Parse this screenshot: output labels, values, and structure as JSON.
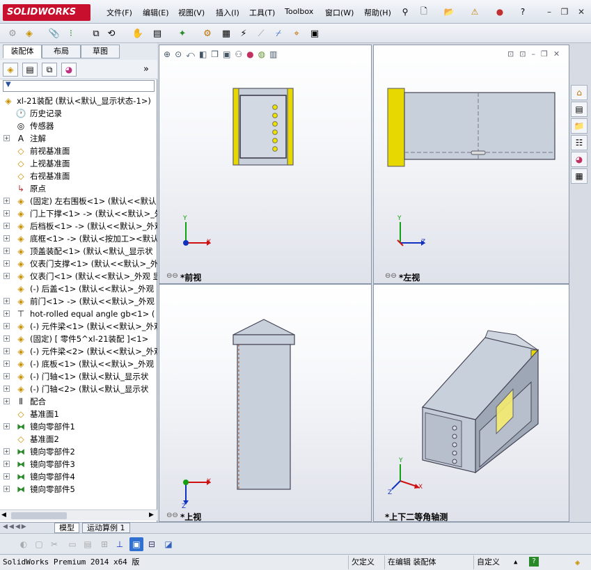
{
  "app": {
    "logo_text": "SOLIDWORKS"
  },
  "menu": [
    {
      "label": "文件(F)"
    },
    {
      "label": "编辑(E)"
    },
    {
      "label": "视图(V)"
    },
    {
      "label": "插入(I)"
    },
    {
      "label": "工具(T)"
    },
    {
      "label": "Toolbox"
    },
    {
      "label": "窗口(W)"
    },
    {
      "label": "帮助(H)"
    }
  ],
  "panel_tabs": [
    {
      "label": "装配体"
    },
    {
      "label": "布局"
    },
    {
      "label": "草图"
    }
  ],
  "tree": {
    "root": "xl-21装配  (默认<默认_显示状态-1>)",
    "items": [
      {
        "label": "历史记录",
        "icon": "history-icon",
        "glyph": "🕐",
        "expand": false
      },
      {
        "label": "传感器",
        "icon": "sensor-icon",
        "glyph": "◎",
        "expand": false
      },
      {
        "label": "注解",
        "icon": "annotation-icon",
        "glyph": "A",
        "expand": true
      },
      {
        "label": "前视基准面",
        "icon": "plane-icon",
        "glyph": "◇",
        "expand": false
      },
      {
        "label": "上视基准面",
        "icon": "plane-icon",
        "glyph": "◇",
        "expand": false
      },
      {
        "label": "右视基准面",
        "icon": "plane-icon",
        "glyph": "◇",
        "expand": false
      },
      {
        "label": "原点",
        "icon": "origin-icon",
        "glyph": "↳",
        "expand": false
      },
      {
        "label": "(固定) 左右围板<1> (默认<<默认",
        "icon": "part-icon",
        "glyph": "◈",
        "expand": true
      },
      {
        "label": "门上下撑<1> -> (默认<<默认>_外",
        "icon": "part-icon",
        "glyph": "◈",
        "expand": true
      },
      {
        "label": "后档板<1> -> (默认<<默认>_外观",
        "icon": "part-icon",
        "glyph": "◈",
        "expand": true
      },
      {
        "label": "底框<1> -> (默认<按加工><默认",
        "icon": "part-icon",
        "glyph": "◈",
        "expand": true
      },
      {
        "label": "顶盖装配<1> (默认<默认_显示状",
        "icon": "subassembly-icon",
        "glyph": "◈",
        "expand": true
      },
      {
        "label": "仪表门支撑<1> (默认<<默认>_外观",
        "icon": "part-icon",
        "glyph": "◈",
        "expand": true
      },
      {
        "label": "仪表门<1> (默认<<默认>_外观 显",
        "icon": "part-icon",
        "glyph": "◈",
        "expand": true
      },
      {
        "label": "(-) 后盖<1> (默认<<默认>_外观",
        "icon": "part-icon",
        "glyph": "◈",
        "expand": false
      },
      {
        "label": "前门<1> -> (默认<<默认>_外观 显",
        "icon": "part-icon",
        "glyph": "◈",
        "expand": true
      },
      {
        "label": "hot-rolled equal angle gb<1> (",
        "icon": "toolbox-part-icon",
        "glyph": "⊤",
        "expand": true
      },
      {
        "label": "(-) 元件梁<1> (默认<<默认>_外观",
        "icon": "part-icon",
        "glyph": "◈",
        "expand": true
      },
      {
        "label": "(固定) [ 零件5^xl-21装配 ]<1>",
        "icon": "part-icon",
        "glyph": "◈",
        "expand": true
      },
      {
        "label": "(-) 元件梁<2> (默认<<默认>_外观",
        "icon": "part-icon",
        "glyph": "◈",
        "expand": true
      },
      {
        "label": "(-) 底板<1> (默认<<默认>_外观",
        "icon": "part-icon",
        "glyph": "◈",
        "expand": true
      },
      {
        "label": "(-) 门轴<1> (默认<默认_显示状",
        "icon": "subassembly-icon",
        "glyph": "◈",
        "expand": true
      },
      {
        "label": "(-) 门轴<2> (默认<默认_显示状",
        "icon": "subassembly-icon",
        "glyph": "◈",
        "expand": true
      },
      {
        "label": "配合",
        "icon": "mates-icon",
        "glyph": "⫴",
        "expand": true
      },
      {
        "label": "基准面1",
        "icon": "plane-icon",
        "glyph": "◇",
        "expand": false
      },
      {
        "label": "镜向零部件1",
        "icon": "mirror-icon",
        "glyph": "⧓",
        "expand": true
      },
      {
        "label": "基准面2",
        "icon": "plane-icon",
        "glyph": "◇",
        "expand": false
      },
      {
        "label": "镜向零部件2",
        "icon": "mirror-icon",
        "glyph": "⧓",
        "expand": true
      },
      {
        "label": "镜向零部件3",
        "icon": "mirror-icon",
        "glyph": "⧓",
        "expand": true
      },
      {
        "label": "镜向零部件4",
        "icon": "mirror-icon",
        "glyph": "⧓",
        "expand": true
      },
      {
        "label": "镜向零部件5",
        "icon": "mirror-icon",
        "glyph": "⧓",
        "expand": true
      }
    ]
  },
  "viewports": {
    "front": "*前视",
    "left": "*左视",
    "top": "*上视",
    "iso": "*上下二等角轴测"
  },
  "axes": {
    "x": "X",
    "y": "Y",
    "z": "Z"
  },
  "bottom_tabs": [
    {
      "label": "模型"
    },
    {
      "label": "运动算例 1"
    }
  ],
  "status": {
    "product": "SolidWorks Premium 2014 x64 版",
    "defined": "欠定义",
    "editing": "在编辑 装配体",
    "units": "自定义",
    "help": "?"
  },
  "colors": {
    "part_gray": "#c9d0dc",
    "part_yellow": "#e6d800",
    "axis_x": "#d01010",
    "axis_y": "#10a010",
    "axis_z": "#1030c0"
  }
}
